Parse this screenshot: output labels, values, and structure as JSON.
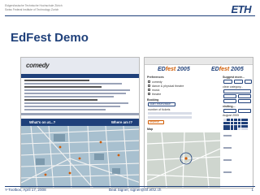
{
  "header": {
    "institution_line1": "Eidgenössische Technische Hochschule Zürich",
    "institution_line2": "Swiss Federal Institute of Technology Zurich",
    "logo": "ETH"
  },
  "slide": {
    "title": "EdFest Demo"
  },
  "left_screenshot": {
    "brand": "comedy",
    "map_header_left": "What's on at...?",
    "map_header_right": "Where am I?"
  },
  "right_screenshot": {
    "brand_prefix": "ED",
    "brand_highlight": "fest",
    "brand_year": "2005",
    "preferences_label": "Preferences",
    "suggest_label": "Suggest more...",
    "comedy_label": "comedy",
    "dance_label": "dance & physical theatre",
    "music_label": "music",
    "theatre_label": "theatre",
    "clear_label": "clear category...",
    "booking_label": "Booking",
    "start_reservation_label": "Start reservation",
    "number_of_tickets_label": "number of tickets",
    "reserve_label": "reserve",
    "map_label": "Map",
    "visiting_label": "visiting...",
    "august_label": "August 2005"
  },
  "footer": {
    "left": "Y-Toolbox, April 17, 2008",
    "center": "Beat Signer, signer@inf.ethz.ch",
    "page": "1"
  },
  "colors": {
    "eth_blue": "#1f407a",
    "accent_orange": "#d05a00",
    "map_water": "#a8c0cf"
  }
}
